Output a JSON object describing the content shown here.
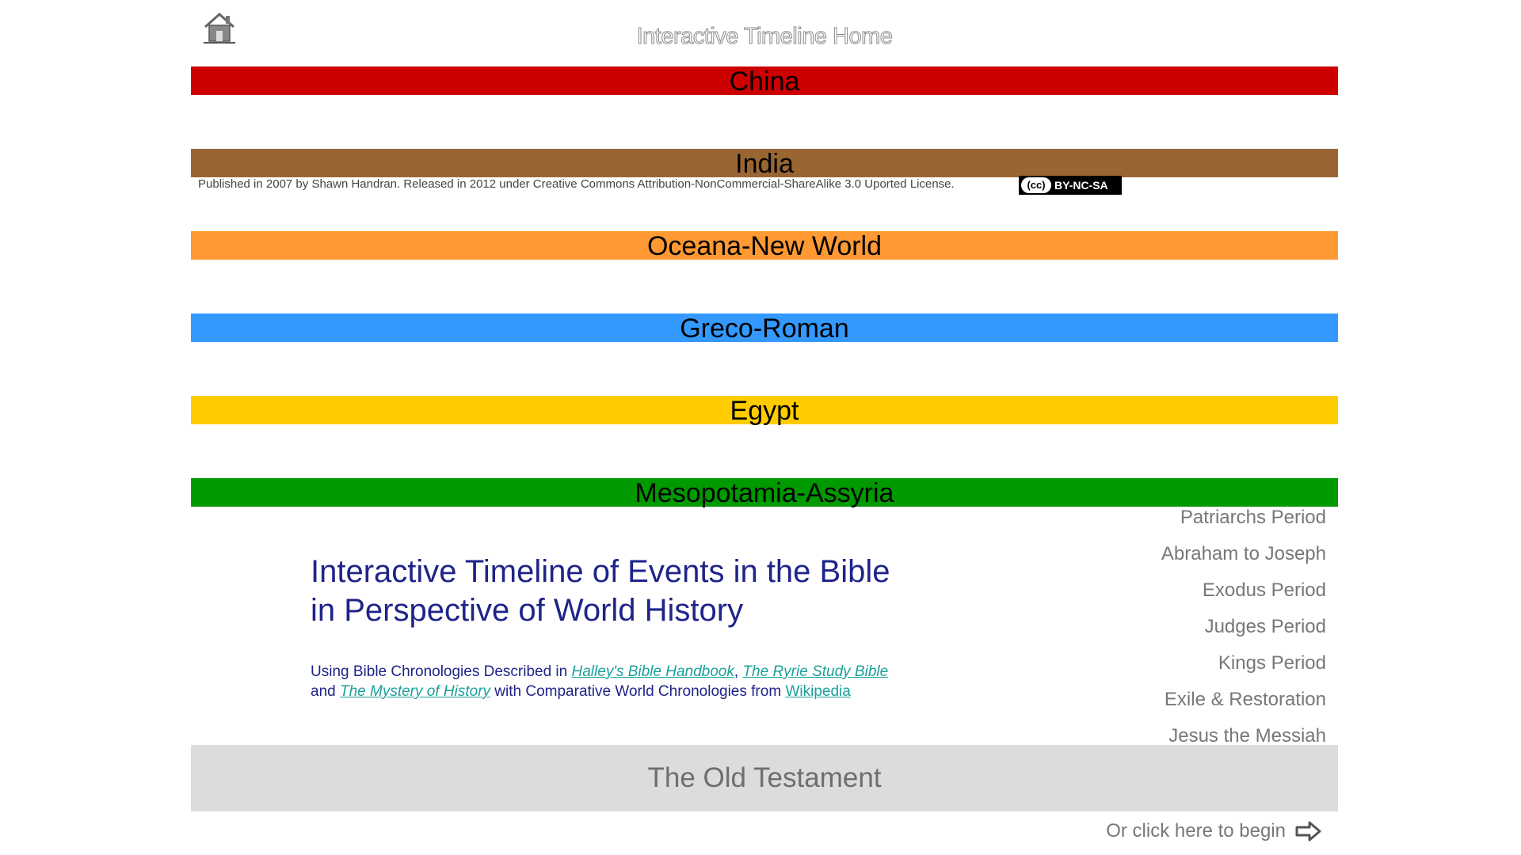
{
  "header": {
    "home_icon": "home-icon",
    "title": "Interactive Timeline Home"
  },
  "bands": [
    {
      "label": "China",
      "color": "#cc0000"
    },
    {
      "label": "India",
      "color": "#996633"
    },
    {
      "label": "Oceana-New World",
      "color": "#ff9933"
    },
    {
      "label": "Greco-Roman",
      "color": "#3399ff"
    },
    {
      "label": "Egypt",
      "color": "#ffcc00"
    },
    {
      "label": "Mesopotamia-Assyria",
      "color": "#009900"
    }
  ],
  "license": {
    "text": "Published in 2007 by Shawn Handran. Released in 2012 under Creative Commons Attribution-NonCommercial-ShareAlike 3.0 Uported License.",
    "badge_cc": "(cc)",
    "badge_terms": "BY-NC-SA"
  },
  "main": {
    "title_line1": "Interactive Timeline of Events in the Bible",
    "title_line2": "in Perspective of World History",
    "sub_prefix": "Using Bible Chronologies Described in ",
    "link_halley": "Halley's Bible Handbook",
    "sep_comma": ", ",
    "link_ryrie": "The Ryrie Study Bible",
    "sub_and": "and ",
    "link_mystery": "The Mystery of History",
    "sub_with": " with Comparative World Chronologies from ",
    "link_wikipedia": "Wikipedia"
  },
  "periods": [
    "Patriarchs Period",
    "Abraham to Joseph",
    "Exodus Period",
    "Judges Period",
    "Kings Period",
    "Exile & Restoration",
    "Jesus the Messiah"
  ],
  "old_testament": "The Old Testament",
  "begin": {
    "label": "Or click here to begin",
    "icon": "arrow-right-icon"
  }
}
